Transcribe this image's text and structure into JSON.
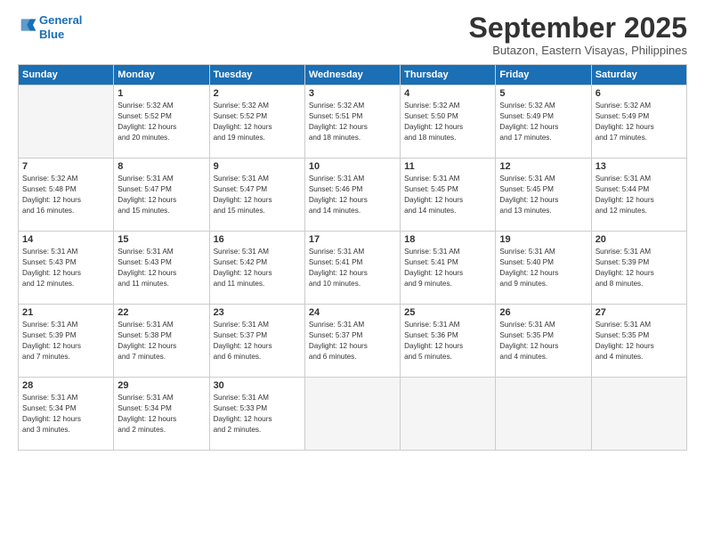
{
  "header": {
    "logo_line1": "General",
    "logo_line2": "Blue",
    "month": "September 2025",
    "location": "Butazon, Eastern Visayas, Philippines"
  },
  "weekdays": [
    "Sunday",
    "Monday",
    "Tuesday",
    "Wednesday",
    "Thursday",
    "Friday",
    "Saturday"
  ],
  "weeks": [
    [
      {
        "day": "",
        "info": ""
      },
      {
        "day": "1",
        "info": "Sunrise: 5:32 AM\nSunset: 5:52 PM\nDaylight: 12 hours\nand 20 minutes."
      },
      {
        "day": "2",
        "info": "Sunrise: 5:32 AM\nSunset: 5:52 PM\nDaylight: 12 hours\nand 19 minutes."
      },
      {
        "day": "3",
        "info": "Sunrise: 5:32 AM\nSunset: 5:51 PM\nDaylight: 12 hours\nand 18 minutes."
      },
      {
        "day": "4",
        "info": "Sunrise: 5:32 AM\nSunset: 5:50 PM\nDaylight: 12 hours\nand 18 minutes."
      },
      {
        "day": "5",
        "info": "Sunrise: 5:32 AM\nSunset: 5:49 PM\nDaylight: 12 hours\nand 17 minutes."
      },
      {
        "day": "6",
        "info": "Sunrise: 5:32 AM\nSunset: 5:49 PM\nDaylight: 12 hours\nand 17 minutes."
      }
    ],
    [
      {
        "day": "7",
        "info": "Sunrise: 5:32 AM\nSunset: 5:48 PM\nDaylight: 12 hours\nand 16 minutes."
      },
      {
        "day": "8",
        "info": "Sunrise: 5:31 AM\nSunset: 5:47 PM\nDaylight: 12 hours\nand 15 minutes."
      },
      {
        "day": "9",
        "info": "Sunrise: 5:31 AM\nSunset: 5:47 PM\nDaylight: 12 hours\nand 15 minutes."
      },
      {
        "day": "10",
        "info": "Sunrise: 5:31 AM\nSunset: 5:46 PM\nDaylight: 12 hours\nand 14 minutes."
      },
      {
        "day": "11",
        "info": "Sunrise: 5:31 AM\nSunset: 5:45 PM\nDaylight: 12 hours\nand 14 minutes."
      },
      {
        "day": "12",
        "info": "Sunrise: 5:31 AM\nSunset: 5:45 PM\nDaylight: 12 hours\nand 13 minutes."
      },
      {
        "day": "13",
        "info": "Sunrise: 5:31 AM\nSunset: 5:44 PM\nDaylight: 12 hours\nand 12 minutes."
      }
    ],
    [
      {
        "day": "14",
        "info": "Sunrise: 5:31 AM\nSunset: 5:43 PM\nDaylight: 12 hours\nand 12 minutes."
      },
      {
        "day": "15",
        "info": "Sunrise: 5:31 AM\nSunset: 5:43 PM\nDaylight: 12 hours\nand 11 minutes."
      },
      {
        "day": "16",
        "info": "Sunrise: 5:31 AM\nSunset: 5:42 PM\nDaylight: 12 hours\nand 11 minutes."
      },
      {
        "day": "17",
        "info": "Sunrise: 5:31 AM\nSunset: 5:41 PM\nDaylight: 12 hours\nand 10 minutes."
      },
      {
        "day": "18",
        "info": "Sunrise: 5:31 AM\nSunset: 5:41 PM\nDaylight: 12 hours\nand 9 minutes."
      },
      {
        "day": "19",
        "info": "Sunrise: 5:31 AM\nSunset: 5:40 PM\nDaylight: 12 hours\nand 9 minutes."
      },
      {
        "day": "20",
        "info": "Sunrise: 5:31 AM\nSunset: 5:39 PM\nDaylight: 12 hours\nand 8 minutes."
      }
    ],
    [
      {
        "day": "21",
        "info": "Sunrise: 5:31 AM\nSunset: 5:39 PM\nDaylight: 12 hours\nand 7 minutes."
      },
      {
        "day": "22",
        "info": "Sunrise: 5:31 AM\nSunset: 5:38 PM\nDaylight: 12 hours\nand 7 minutes."
      },
      {
        "day": "23",
        "info": "Sunrise: 5:31 AM\nSunset: 5:37 PM\nDaylight: 12 hours\nand 6 minutes."
      },
      {
        "day": "24",
        "info": "Sunrise: 5:31 AM\nSunset: 5:37 PM\nDaylight: 12 hours\nand 6 minutes."
      },
      {
        "day": "25",
        "info": "Sunrise: 5:31 AM\nSunset: 5:36 PM\nDaylight: 12 hours\nand 5 minutes."
      },
      {
        "day": "26",
        "info": "Sunrise: 5:31 AM\nSunset: 5:35 PM\nDaylight: 12 hours\nand 4 minutes."
      },
      {
        "day": "27",
        "info": "Sunrise: 5:31 AM\nSunset: 5:35 PM\nDaylight: 12 hours\nand 4 minutes."
      }
    ],
    [
      {
        "day": "28",
        "info": "Sunrise: 5:31 AM\nSunset: 5:34 PM\nDaylight: 12 hours\nand 3 minutes."
      },
      {
        "day": "29",
        "info": "Sunrise: 5:31 AM\nSunset: 5:34 PM\nDaylight: 12 hours\nand 2 minutes."
      },
      {
        "day": "30",
        "info": "Sunrise: 5:31 AM\nSunset: 5:33 PM\nDaylight: 12 hours\nand 2 minutes."
      },
      {
        "day": "",
        "info": ""
      },
      {
        "day": "",
        "info": ""
      },
      {
        "day": "",
        "info": ""
      },
      {
        "day": "",
        "info": ""
      }
    ]
  ]
}
